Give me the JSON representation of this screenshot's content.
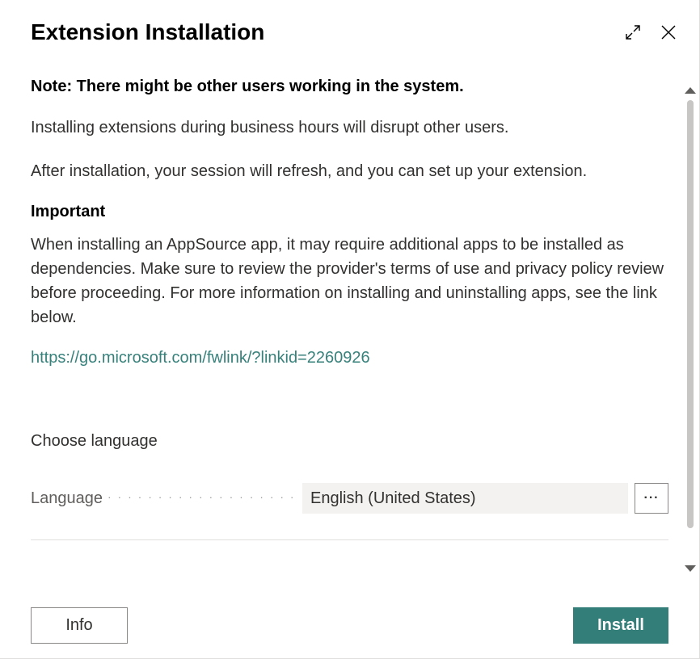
{
  "header": {
    "title": "Extension Installation"
  },
  "content": {
    "note_heading": "Note: There might be other users working in the system.",
    "para1": "Installing extensions during business hours will disrupt other users.",
    "para2": "After installation, your session will refresh, and you can set up your extension.",
    "important_heading": "Important",
    "important_body": "When installing an AppSource app, it may require additional apps to be installed as dependencies. Make sure to review the provider's terms of use and privacy policy review before proceeding. For more information on installing and uninstalling apps, see the link below.",
    "link_text": "https://go.microsoft.com/fwlink/?linkid=2260926",
    "choose_language": "Choose language",
    "language_label": "Language",
    "language_value": "English (United States)",
    "more_label": "···"
  },
  "footer": {
    "info_label": "Info",
    "install_label": "Install"
  }
}
